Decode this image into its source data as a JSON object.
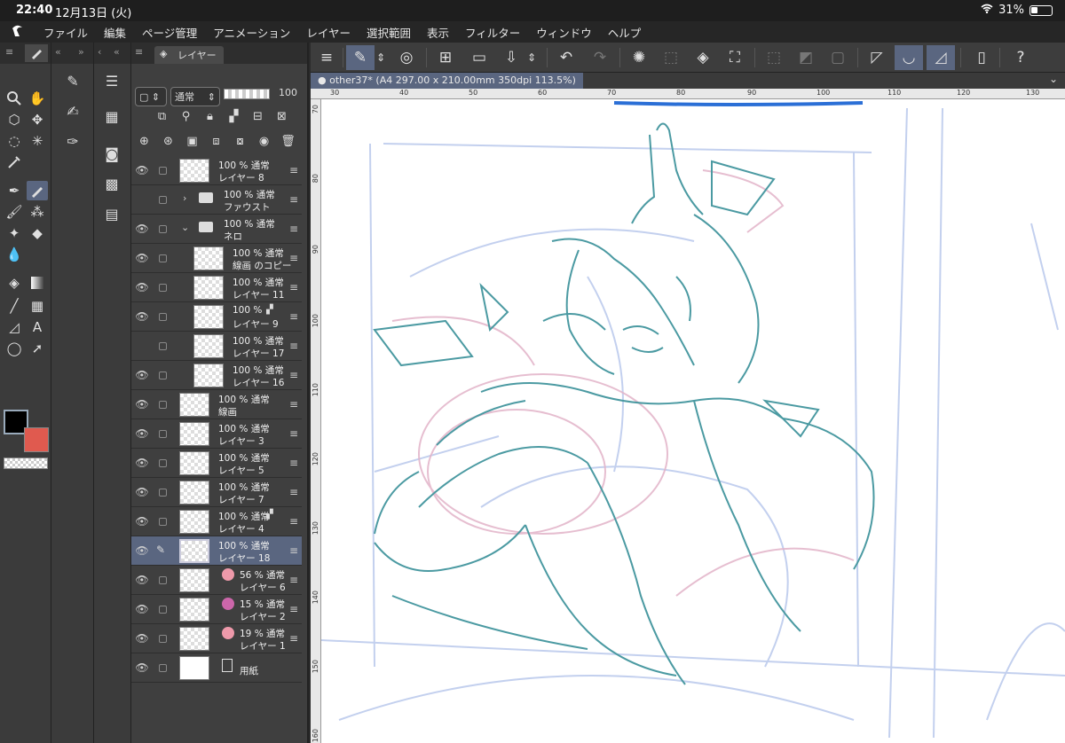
{
  "status": {
    "time": "22:40",
    "date": "12月13日 (火)",
    "battery": "31%"
  },
  "menu": [
    "ファイル",
    "編集",
    "ページ管理",
    "アニメーション",
    "レイヤー",
    "選択範囲",
    "表示",
    "フィルター",
    "ウィンドウ",
    "ヘルプ"
  ],
  "layer_panel": {
    "tab_label": "レイヤー",
    "blend_mode": "通常",
    "opacity": "100"
  },
  "document": {
    "tab_title": "other37* (A4 297.00 x 210.00mm 350dpi 113.5%)"
  },
  "ruler": {
    "h": [
      "30",
      "40",
      "50",
      "60",
      "70",
      "80",
      "90",
      "100",
      "110",
      "120",
      "130"
    ],
    "v": [
      "70",
      "80",
      "90",
      "100",
      "110",
      "120",
      "130",
      "140",
      "150",
      "160"
    ]
  },
  "layers": [
    {
      "pct": "100 %  通常",
      "name": "レイヤー 8"
    },
    {
      "pct": "100 %  通常",
      "name": "ファウスト"
    },
    {
      "pct": "100 %  通常",
      "name": "ネロ"
    },
    {
      "pct": "100 %  通常",
      "name": "線画 のコピー"
    },
    {
      "pct": "100 %  通常",
      "name": "レイヤー 11"
    },
    {
      "pct": "100 %",
      "name": "レイヤー 9"
    },
    {
      "pct": "100 %  通常",
      "name": "レイヤー 17"
    },
    {
      "pct": "100 %  通常",
      "name": "レイヤー 16"
    },
    {
      "pct": "100 %  通常",
      "name": "線画"
    },
    {
      "pct": "100 %  通常",
      "name": "レイヤー 3"
    },
    {
      "pct": "100 %  通常",
      "name": "レイヤー 5"
    },
    {
      "pct": "100 %  通常",
      "name": "レイヤー 7"
    },
    {
      "pct": "100 %  通常",
      "name": "レイヤー 4"
    },
    {
      "pct": "100 %  通常",
      "name": "レイヤー 18"
    },
    {
      "pct": "56 %  通常",
      "name": "レイヤー 6"
    },
    {
      "pct": "15 %  通常",
      "name": "レイヤー 2"
    },
    {
      "pct": "19 %  通常",
      "name": "レイヤー 1"
    },
    {
      "pct": "",
      "name": "用紙"
    }
  ],
  "colors": {
    "main": "#000000",
    "sub": "#e05a4f",
    "accent": "#5a6680"
  }
}
